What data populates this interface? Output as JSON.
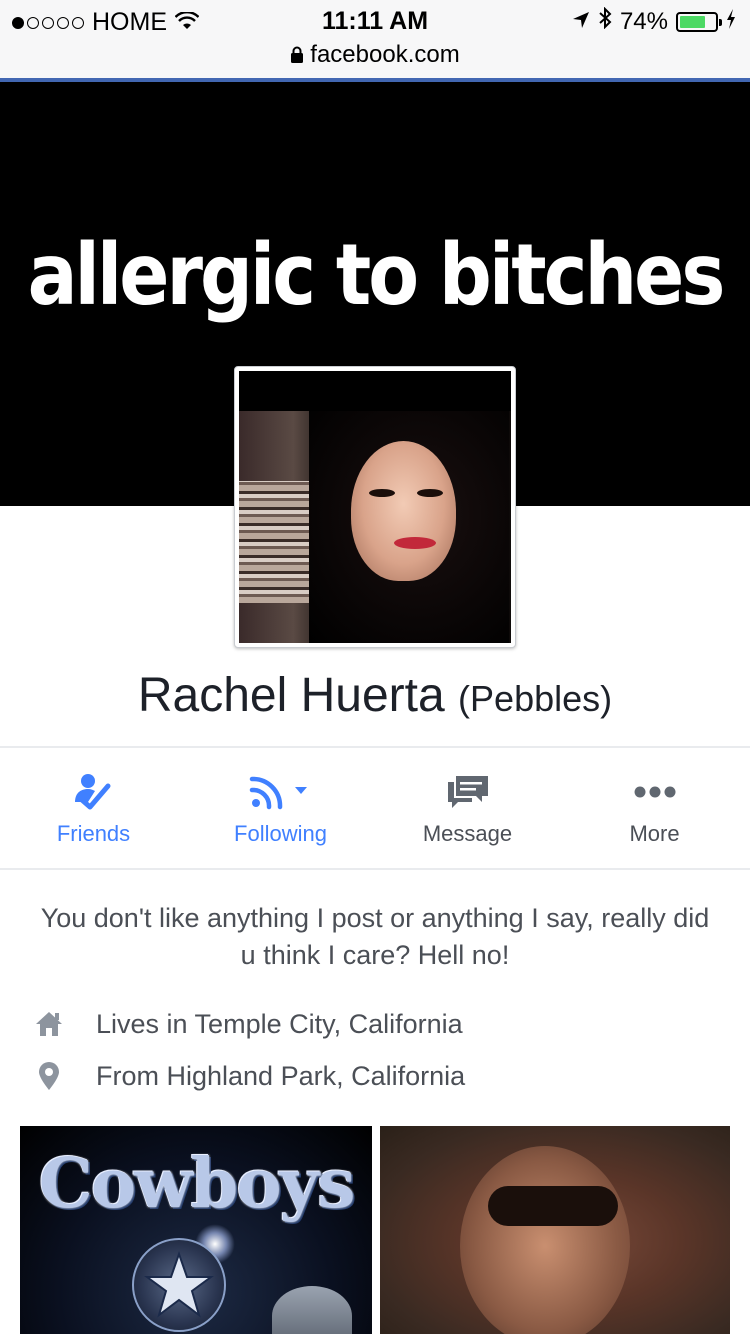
{
  "status_bar": {
    "carrier": "HOME",
    "time": "11:11 AM",
    "battery_percent_text": "74%",
    "battery_level": 0.74,
    "signal_bars_filled": 1,
    "signal_bars_total": 5
  },
  "browser": {
    "url": "facebook.com"
  },
  "cover": {
    "text": "allergic to bitches"
  },
  "profile": {
    "name": "Rachel Huerta",
    "nickname": "(Pebbles)"
  },
  "actions": [
    {
      "label": "Friends",
      "icon": "friends-check-icon",
      "color": "#4080ff"
    },
    {
      "label": "Following",
      "icon": "rss-icon",
      "color": "#4080ff"
    },
    {
      "label": "Message",
      "icon": "message-icon",
      "color": "#4b4f56"
    },
    {
      "label": "More",
      "icon": "more-dots-icon",
      "color": "#4b4f56"
    }
  ],
  "bio": "You don't like anything I post or anything I say, really did u think I care? Hell no!",
  "info": [
    {
      "icon": "home-icon",
      "text": "Lives in Temple City, California"
    },
    {
      "icon": "location-pin-icon",
      "text": "From Highland Park, California"
    }
  ],
  "photos": {
    "first_caption_art": "Cowboys"
  },
  "colors": {
    "brand_blue": "#4267b2",
    "action_blue": "#4080ff",
    "text_gray": "#4b4f56"
  }
}
